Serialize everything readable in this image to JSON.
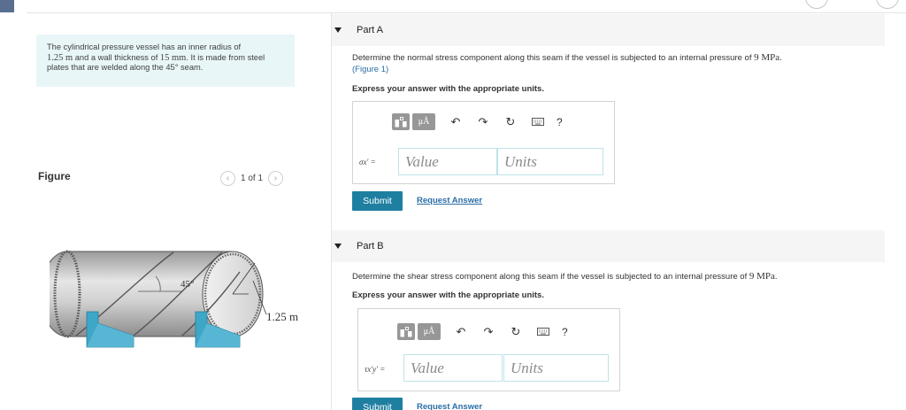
{
  "problem": {
    "text_1": "The cylindrical pressure vessel has an inner radius of",
    "radius_value": "1.25 m",
    "text_2": " and a wall thickness of ",
    "thickness_value": "15 mm",
    "text_3": ". It is made from steel plates that are welded along the 45° seam."
  },
  "figure_panel": {
    "label": "Figure",
    "pager_text": "1 of 1",
    "prev_symbol": "‹",
    "next_symbol": "›",
    "angle_label": "45°",
    "radius_label": "1.25 m"
  },
  "part_a": {
    "title": "Part A",
    "question_1": "Determine the normal stress component along this seam if the vessel is subjected to an internal pressure of ",
    "pressure": "9 MPa",
    "question_2": ".",
    "figure_link": "(Figure 1)",
    "instruction": "Express your answer with the appropriate units.",
    "variable_label": "σx' =",
    "value_placeholder": "Value",
    "units_placeholder": "Units",
    "submit_label": "Submit",
    "request_label": "Request Answer"
  },
  "part_b": {
    "title": "Part B",
    "question_1": "Determine the shear stress component along this seam if the vessel is subjected to an internal pressure of ",
    "pressure": "9 MPa",
    "question_2": ".",
    "instruction": "Express your answer with the appropriate units.",
    "variable_label": "τx'y' =",
    "value_placeholder": "Value",
    "units_placeholder": "Units",
    "submit_label": "Submit",
    "request_label": "Request Answer"
  },
  "toolbar": {
    "unit_symbol": "μÅ",
    "undo_symbol": "↶",
    "redo_symbol": "↷",
    "reset_symbol": "↻",
    "help_symbol": "?"
  },
  "colors": {
    "accent": "#1e7fa1",
    "link": "#2a6ea8",
    "problem_bg": "#e8f6f8",
    "pipe_stand": "#3ea7c8"
  }
}
